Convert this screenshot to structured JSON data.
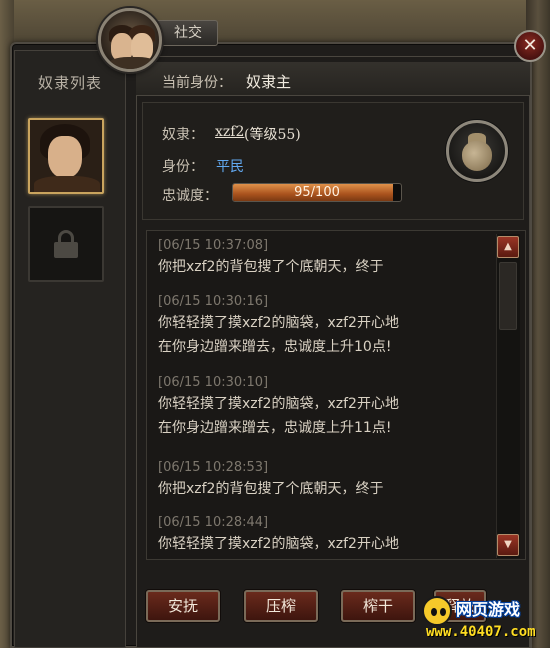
{
  "window": {
    "title": "社交",
    "close": "✕"
  },
  "sidebar": {
    "title": "奴隶列表"
  },
  "identity": {
    "label": "当前身份：",
    "value": "奴隶主"
  },
  "slave": {
    "name_label": "奴隶：",
    "name": "xzf2",
    "level": "(等级55)",
    "status_label": "身份：",
    "status": "平民",
    "loyalty_label": "忠诚度：",
    "loyalty_text": "95/100",
    "loyalty_fraction": 0.95
  },
  "log": [
    {
      "time": "[06/15 10:37:08]",
      "lines": [
        "你把xzf2的背包搜了个底朝天，终于"
      ]
    },
    {
      "time": "[06/15 10:30:16]",
      "lines": [
        "你轻轻摸了摸xzf2的脑袋，xzf2开心地",
        "在你身边蹭来蹭去，忠诚度上升10点!"
      ]
    },
    {
      "time": "[06/15 10:30:10]",
      "lines": [
        "你轻轻摸了摸xzf2的脑袋，xzf2开心地",
        "在你身边蹭来蹭去，忠诚度上升11点!"
      ]
    },
    {
      "time": "[06/15 10:28:53]",
      "lines": [
        "你把xzf2的背包搜了个底朝天，终于"
      ]
    },
    {
      "time": "[06/15 10:28:44]",
      "lines": [
        "你轻轻摸了摸xzf2的脑袋，xzf2开心地"
      ]
    }
  ],
  "buttons": {
    "comfort": "安抚",
    "squeeze": "压榨",
    "drain": "榨干",
    "release": "释放"
  },
  "watermark": {
    "title": "网页游戏",
    "url": "www.40407.com"
  }
}
